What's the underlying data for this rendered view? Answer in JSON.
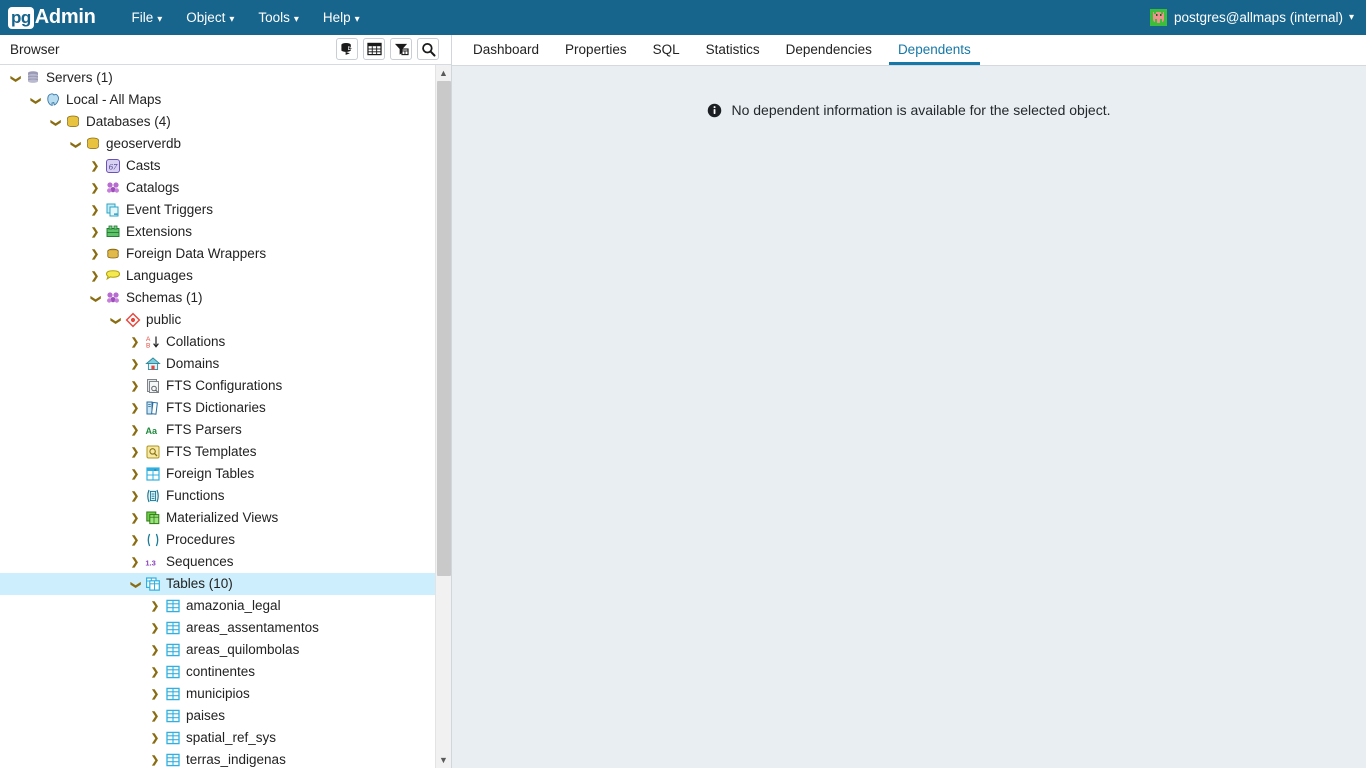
{
  "header": {
    "logo_pg": "pg",
    "logo_admin": "Admin",
    "menus": [
      {
        "label": "File",
        "caret": "⌄",
        "icon": "chevron-down-icon"
      },
      {
        "label": "Object",
        "caret": "⌄",
        "icon": "chevron-down-icon"
      },
      {
        "label": "Tools",
        "caret": "⌄",
        "icon": "chevron-down-icon"
      },
      {
        "label": "Help",
        "caret": "⌄",
        "icon": "chevron-down-icon"
      }
    ],
    "user": {
      "label": "postgres@allmaps (internal)",
      "caret": "⌄",
      "icon": "elephant-icon"
    },
    "background_color": "#17648d"
  },
  "browser": {
    "title": "Browser",
    "tools": [
      {
        "name": "query-tool-icon",
        "title": "Query Tool"
      },
      {
        "name": "view-data-icon",
        "title": "View Data"
      },
      {
        "name": "filter-icon",
        "title": "Filtered Rows"
      },
      {
        "name": "search-icon",
        "title": "Search Objects"
      }
    ],
    "scrollbar": {
      "up_arrow": "▲",
      "down_arrow": "▼"
    }
  },
  "tree": {
    "selected_label": "Tables (10)",
    "selection_color": "#cdeefc",
    "selection_marker_color": "#0c6b93",
    "nodes": [
      {
        "label": "Servers (1)",
        "depth": 0,
        "state": "expanded",
        "icon": "servers-icon"
      },
      {
        "label": "Local - All Maps",
        "depth": 1,
        "state": "expanded",
        "icon": "server-icon"
      },
      {
        "label": "Databases (4)",
        "depth": 2,
        "state": "expanded",
        "icon": "databases-icon"
      },
      {
        "label": "geoserverdb",
        "depth": 3,
        "state": "expanded",
        "icon": "database-icon"
      },
      {
        "label": "Casts",
        "depth": 4,
        "state": "collapsed",
        "icon": "cast-icon"
      },
      {
        "label": "Catalogs",
        "depth": 4,
        "state": "collapsed",
        "icon": "catalog-icon"
      },
      {
        "label": "Event Triggers",
        "depth": 4,
        "state": "collapsed",
        "icon": "event-trigger-icon"
      },
      {
        "label": "Extensions",
        "depth": 4,
        "state": "collapsed",
        "icon": "extension-icon"
      },
      {
        "label": "Foreign Data Wrappers",
        "depth": 4,
        "state": "collapsed",
        "icon": "foreign-data-wrapper-icon"
      },
      {
        "label": "Languages",
        "depth": 4,
        "state": "collapsed",
        "icon": "language-icon"
      },
      {
        "label": "Schemas (1)",
        "depth": 4,
        "state": "expanded",
        "icon": "schemas-icon"
      },
      {
        "label": "public",
        "depth": 5,
        "state": "expanded",
        "icon": "schema-icon"
      },
      {
        "label": "Collations",
        "depth": 6,
        "state": "collapsed",
        "icon": "collation-icon"
      },
      {
        "label": "Domains",
        "depth": 6,
        "state": "collapsed",
        "icon": "domain-icon"
      },
      {
        "label": "FTS Configurations",
        "depth": 6,
        "state": "collapsed",
        "icon": "fts-configuration-icon"
      },
      {
        "label": "FTS Dictionaries",
        "depth": 6,
        "state": "collapsed",
        "icon": "fts-dictionary-icon"
      },
      {
        "label": "FTS Parsers",
        "depth": 6,
        "state": "collapsed",
        "icon": "fts-parser-icon"
      },
      {
        "label": "FTS Templates",
        "depth": 6,
        "state": "collapsed",
        "icon": "fts-template-icon"
      },
      {
        "label": "Foreign Tables",
        "depth": 6,
        "state": "collapsed",
        "icon": "foreign-table-icon"
      },
      {
        "label": "Functions",
        "depth": 6,
        "state": "collapsed",
        "icon": "function-icon"
      },
      {
        "label": "Materialized Views",
        "depth": 6,
        "state": "collapsed",
        "icon": "materialized-view-icon"
      },
      {
        "label": "Procedures",
        "depth": 6,
        "state": "collapsed",
        "icon": "procedure-icon"
      },
      {
        "label": "Sequences",
        "depth": 6,
        "state": "collapsed",
        "icon": "sequence-icon"
      },
      {
        "label": "Tables (10)",
        "depth": 6,
        "state": "expanded",
        "icon": "tables-icon",
        "selected": true
      },
      {
        "label": "amazonia_legal",
        "depth": 7,
        "state": "collapsed",
        "icon": "table-icon"
      },
      {
        "label": "areas_assentamentos",
        "depth": 7,
        "state": "collapsed",
        "icon": "table-icon"
      },
      {
        "label": "areas_quilombolas",
        "depth": 7,
        "state": "collapsed",
        "icon": "table-icon"
      },
      {
        "label": "continentes",
        "depth": 7,
        "state": "collapsed",
        "icon": "table-icon"
      },
      {
        "label": "municipios",
        "depth": 7,
        "state": "collapsed",
        "icon": "table-icon"
      },
      {
        "label": "paises",
        "depth": 7,
        "state": "collapsed",
        "icon": "table-icon"
      },
      {
        "label": "spatial_ref_sys",
        "depth": 7,
        "state": "collapsed",
        "icon": "table-icon"
      },
      {
        "label": "terras_indigenas",
        "depth": 7,
        "state": "collapsed",
        "icon": "table-icon"
      }
    ]
  },
  "content": {
    "tabs": [
      {
        "label": "Dashboard",
        "active": false
      },
      {
        "label": "Properties",
        "active": false
      },
      {
        "label": "SQL",
        "active": false
      },
      {
        "label": "Statistics",
        "active": false
      },
      {
        "label": "Dependencies",
        "active": false
      },
      {
        "label": "Dependents",
        "active": true
      }
    ],
    "active_tab_color": "#1678a8",
    "message": "No dependent information is available for the selected object.",
    "message_icon": "info-icon",
    "background_color": "#e9eef2"
  }
}
